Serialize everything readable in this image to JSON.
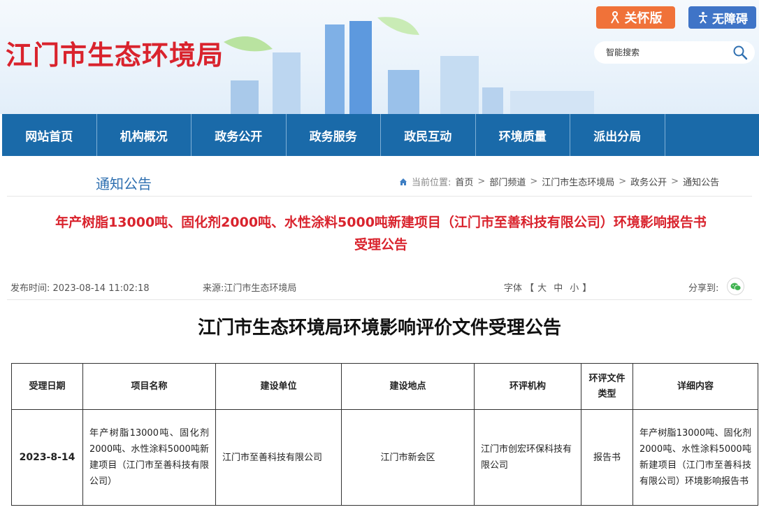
{
  "header": {
    "site_title": "江门市生态环境局",
    "care_label": "关怀版",
    "access_label": "无障碍",
    "search_placeholder": "智能搜索"
  },
  "nav": {
    "items": [
      "网站首页",
      "机构概况",
      "政务公开",
      "政务服务",
      "政民互动",
      "环境质量",
      "派出分局"
    ]
  },
  "section": {
    "title": "通知公告",
    "breadcrumb_label": "当前位置:",
    "breadcrumb": [
      "首页",
      "部门频道",
      "江门市生态环境局",
      "政务公开",
      "通知公告"
    ]
  },
  "article": {
    "title_line1": "年产树脂13000吨、固化剂2000吨、水性涂料5000吨新建项目（江门市至善科技有限公司）环境影响报告书",
    "title_line2": "受理公告",
    "date_label": "发布时间:",
    "date": "2023-08-14 11:02:18",
    "source_label": "来源:",
    "source": "江门市生态环境局",
    "font_label": "字体",
    "font_open": "【",
    "font_large": "大",
    "font_medium": "中",
    "font_small": "小",
    "font_close": "】",
    "share_label": "分享到:",
    "doc_title": "江门市生态环境局环境影响评价文件受理公告"
  },
  "table": {
    "headers": [
      "受理日期",
      "项目名称",
      "建设单位",
      "建设地点",
      "环评机构",
      "环评文件类型",
      "详细内容"
    ],
    "rows": [
      [
        "2023-8-14",
        "年产树脂13000吨、固化剂2000吨、水性涂料5000吨新建项目（江门市至善科技有限公司）",
        "江门市至善科技有限公司",
        "江门市新会区",
        "江门市创宏环保科技有限公司",
        "报告书",
        "年产树脂13000吨、固化剂2000吨、水性涂料5000吨新建项目（江门市至善科技有限公司）环境影响报告书"
      ]
    ]
  },
  "colors": {
    "brand_red": "#d9232d",
    "nav_blue": "#1a6aa9",
    "care_orange": "#f07239",
    "access_blue": "#3f74c7",
    "section_blue": "#2e6fb0"
  }
}
